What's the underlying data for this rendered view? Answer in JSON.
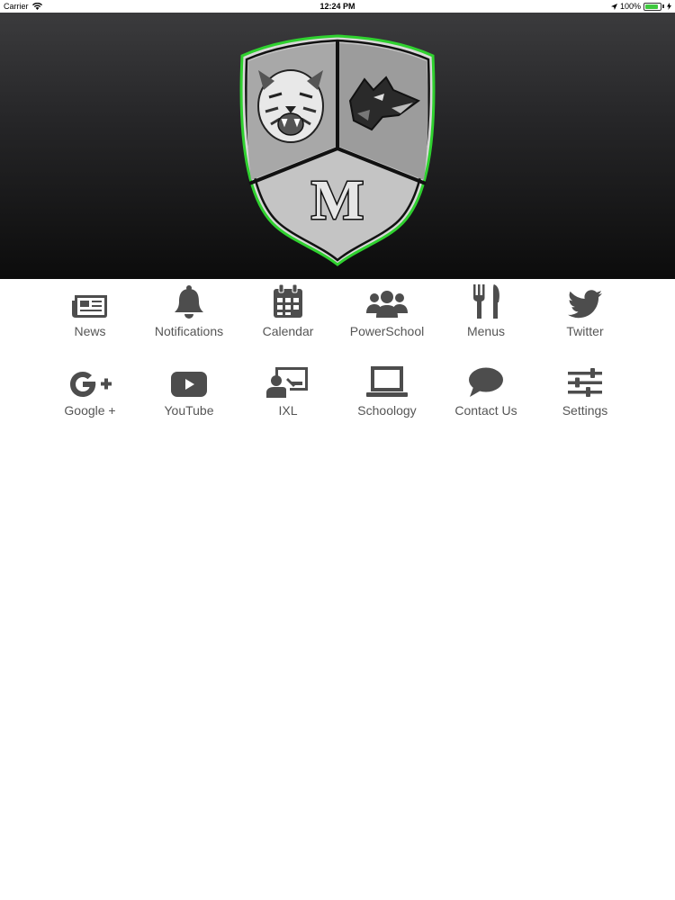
{
  "status_bar": {
    "carrier": "Carrier",
    "time": "12:24 PM",
    "battery": "100%",
    "battery_level": 1.0
  },
  "hero": {
    "logo_letter": "M",
    "accent_color": "#2fd12f"
  },
  "tiles": [
    {
      "label": "News",
      "icon": "newspaper-icon"
    },
    {
      "label": "Notifications",
      "icon": "bell-icon"
    },
    {
      "label": "Calendar",
      "icon": "calendar-icon"
    },
    {
      "label": "PowerSchool",
      "icon": "users-icon"
    },
    {
      "label": "Menus",
      "icon": "fork-knife-icon"
    },
    {
      "label": "Twitter",
      "icon": "twitter-icon"
    },
    {
      "label": "Google +",
      "icon": "google-plus-icon"
    },
    {
      "label": "YouTube",
      "icon": "youtube-icon"
    },
    {
      "label": "IXL",
      "icon": "presenter-icon"
    },
    {
      "label": "Schoology",
      "icon": "laptop-icon"
    },
    {
      "label": "Contact Us",
      "icon": "chat-bubble-icon"
    },
    {
      "label": "Settings",
      "icon": "sliders-icon"
    }
  ]
}
